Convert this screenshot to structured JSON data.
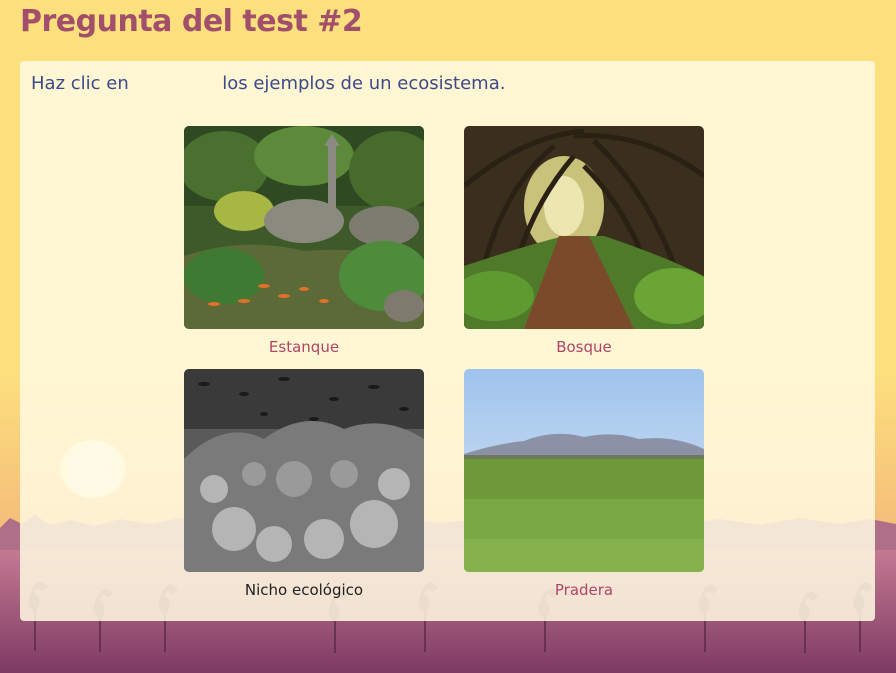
{
  "header": {
    "title": "Pregunta del test #2"
  },
  "question": {
    "prompt_before": "Haz clic en",
    "prompt_after": "los ejemplos de un ecosistema."
  },
  "options": [
    {
      "label": "Estanque",
      "image": "pond-garden-image",
      "selected": false
    },
    {
      "label": "Bosque",
      "image": "forest-path-image",
      "selected": false
    },
    {
      "label": "Nicho ecológico",
      "image": "coral-reef-image",
      "selected": true
    },
    {
      "label": "Pradera",
      "image": "grassland-image",
      "selected": false
    }
  ],
  "colors": {
    "title": "#a24f6b",
    "prompt": "#3b4a8a",
    "caption": "#b0456a",
    "caption_selected": "#222222",
    "background": "#fde07e",
    "panel": "#fff9e1"
  }
}
